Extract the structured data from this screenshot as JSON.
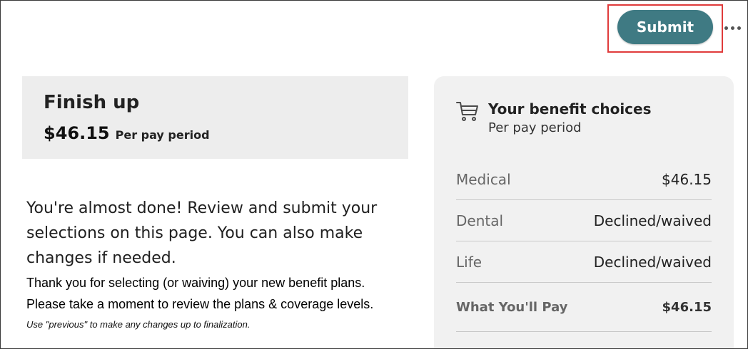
{
  "toolbar": {
    "submit_label": "Submit",
    "more_icon": "more-horizontal-icon",
    "accent_color": "#3f7a83",
    "highlight_color": "#e03b3b"
  },
  "finish": {
    "title": "Finish up",
    "amount": "$46.15",
    "per_period": "Per pay period"
  },
  "body": {
    "intro": "You're almost done! Review and submit your selections on this page. You can also make changes if needed.",
    "note_line1": "Thank you for selecting (or waiving) your new benefit plans.",
    "note_line2": "Please take a moment to review the plans & coverage levels.",
    "hint": "Use \"previous\" to make any changes up to finalization."
  },
  "choices": {
    "icon": "cart-icon",
    "title": "Your benefit choices",
    "subtitle": "Per pay period",
    "rows": [
      {
        "label": "Medical",
        "value": "$46.15"
      },
      {
        "label": "Dental",
        "value": "Declined/waived"
      },
      {
        "label": "Life",
        "value": "Declined/waived"
      }
    ],
    "total": {
      "label": "What You'll Pay",
      "value": "$46.15"
    }
  }
}
